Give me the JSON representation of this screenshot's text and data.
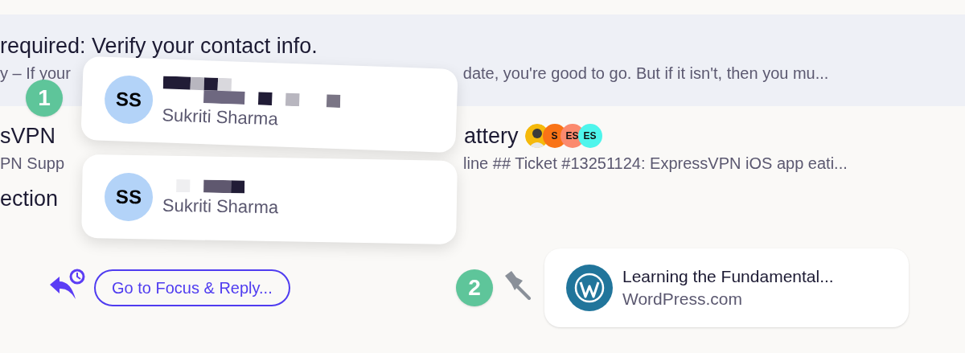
{
  "rows": [
    {
      "selected": true,
      "title": [
        "required: Verify your contact info."
      ],
      "preview": [
        "y – If your",
        "date, you're good to go. But if it isn't, then you mu..."
      ]
    },
    {
      "selected": false,
      "title": [
        "sVPN",
        "attery"
      ],
      "participants": [
        {
          "kind": "photo"
        },
        {
          "kind": "initials",
          "initials": "S",
          "color": "#f97316"
        },
        {
          "kind": "initials",
          "initials": "ES",
          "color": "#fb8a6e"
        },
        {
          "kind": "initials",
          "initials": "ES",
          "color": "#4ef5ec"
        }
      ],
      "preview": [
        "PN Supp",
        "line ## Ticket #13251124: ExpressVPN iOS app eati..."
      ]
    },
    {
      "selected": false,
      "title": [
        "ection"
      ]
    }
  ],
  "contact_cards": [
    {
      "initials": "SS",
      "name": "Sukriti Sharma"
    },
    {
      "initials": "SS",
      "name": "Sukriti Sharma"
    }
  ],
  "steps": [
    "1",
    "2"
  ],
  "focus_button": {
    "label": "Go to Focus & Reply..."
  },
  "pinned_link": {
    "title": "Learning the Fundamental...",
    "site": "WordPress.com"
  }
}
